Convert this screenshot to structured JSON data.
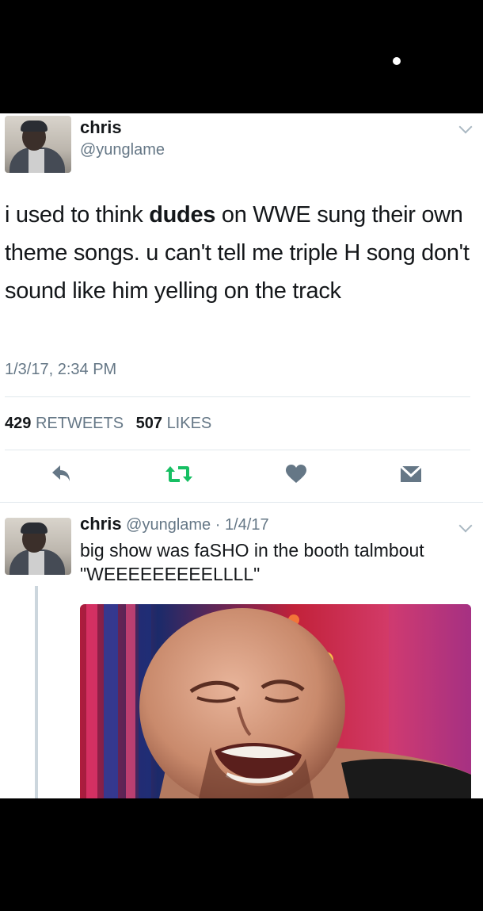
{
  "tweet": {
    "name": "chris",
    "handle": "@yunglame",
    "text_before": "i used to think ",
    "text_bold": "dudes",
    "text_after": " on WWE sung their own theme songs. u can't tell me triple H song don't sound like him yelling on the track",
    "timestamp": "1/3/17, 2:34 PM",
    "retweets_count": "429",
    "retweets_label": "RETWEETS",
    "likes_count": "507",
    "likes_label": "LIKES"
  },
  "reply": {
    "name": "chris",
    "handle": "@yunglame",
    "separator": "·",
    "date": "1/4/17",
    "text": "big show was faSHO in the booth talmbout \"WEEEEEEEEELLLL\""
  },
  "icons": {
    "reply": "reply-arrow",
    "retweet": "retweet-arrows",
    "like": "heart",
    "message": "envelope",
    "more": "chevron-down"
  },
  "colors": {
    "retweet_green": "#17bf63",
    "icon_gray": "#657786",
    "secondary_text": "#657786"
  }
}
